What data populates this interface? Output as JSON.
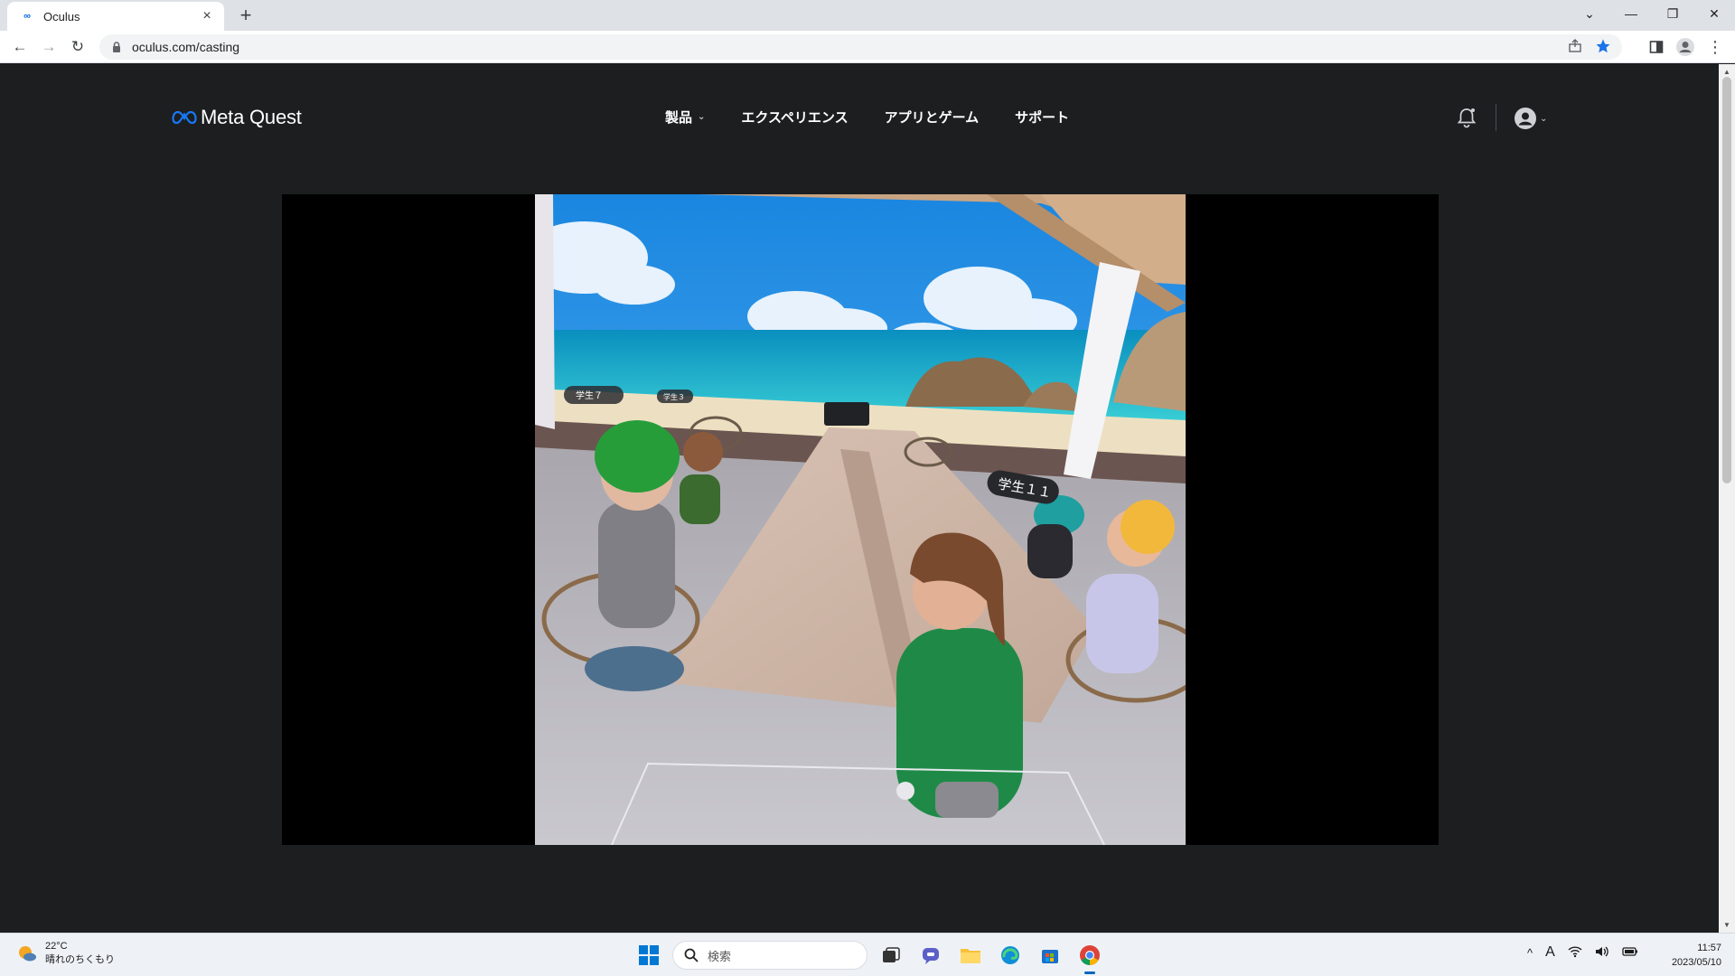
{
  "browser": {
    "tab_title": "Oculus",
    "tab_close": "×",
    "new_tab": "+",
    "url": "oculus.com/casting",
    "window_controls": {
      "chevron": "⌄",
      "minimize": "—",
      "restore": "❐",
      "close": "✕"
    },
    "nav": {
      "back": "←",
      "forward": "→",
      "reload": "↻"
    }
  },
  "site": {
    "logo_text": "Meta Quest",
    "nav_items": [
      {
        "label": "製品",
        "has_dropdown": true
      },
      {
        "label": "エクスペリエンス",
        "has_dropdown": false
      },
      {
        "label": "アプリとゲーム",
        "has_dropdown": false
      },
      {
        "label": "サポート",
        "has_dropdown": false
      }
    ],
    "dropdown_chevron": "⌄"
  },
  "vr_scene": {
    "name_tags": [
      "学生７",
      "学生３",
      "学生１１"
    ]
  },
  "taskbar": {
    "weather_temp": "22°C",
    "weather_desc": "晴れのちくもり",
    "search_placeholder": "検索",
    "tray_ime": "A",
    "tray_chevron": "^",
    "time": "11:57",
    "date": "2023/05/10"
  },
  "colors": {
    "page_bg": "#1c1e20",
    "accent_blue": "#0668e1",
    "windows_blue": "#0067c0"
  }
}
